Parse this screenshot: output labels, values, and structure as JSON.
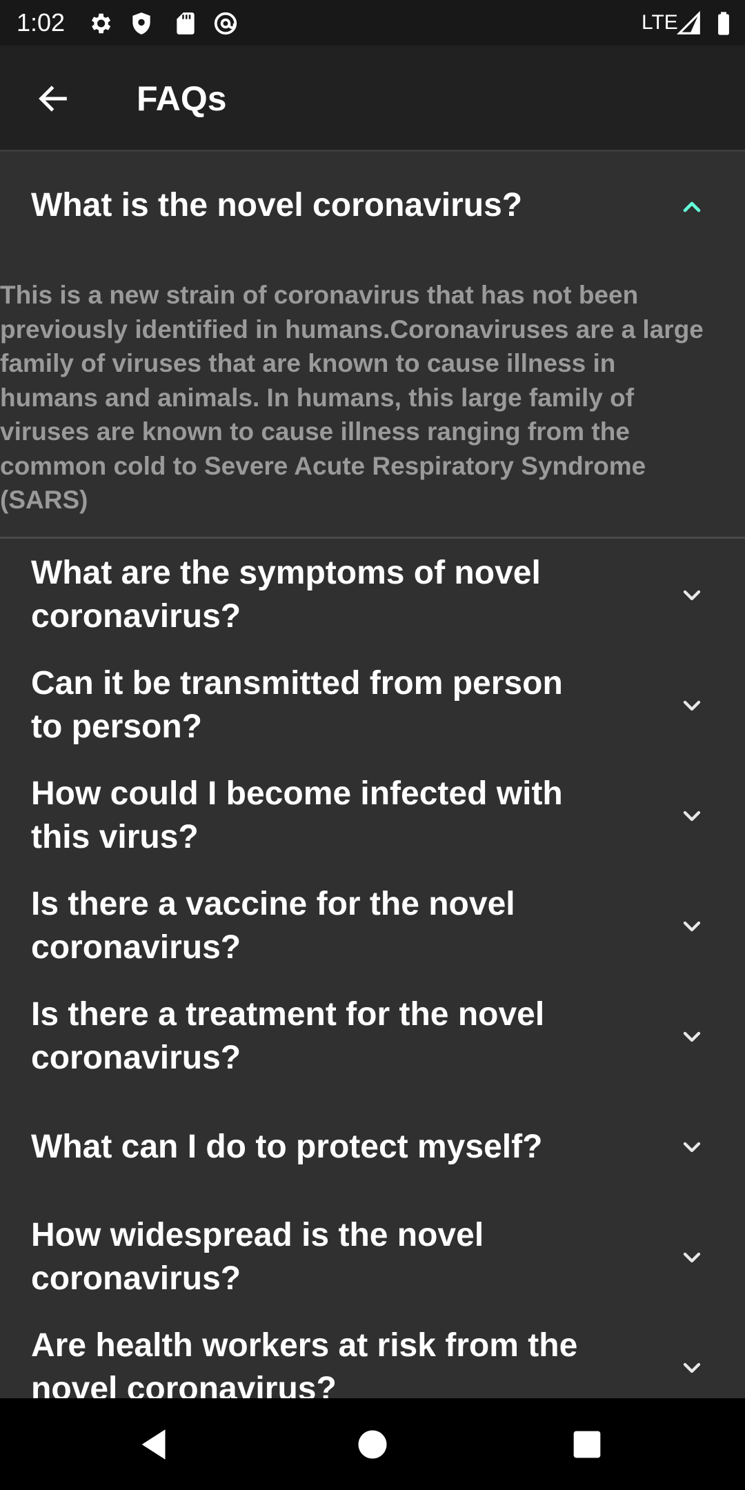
{
  "status_bar": {
    "time": "1:02",
    "network": "LTE",
    "icons": [
      "gear-icon",
      "shield-icon",
      "sd-card-icon",
      "at-sign-icon",
      "signal-icon",
      "battery-icon"
    ]
  },
  "app_bar": {
    "title": "FAQs",
    "back_icon": "arrow-back-icon"
  },
  "colors": {
    "background": "#303030",
    "app_bar": "#212121",
    "status_bar": "#181818",
    "accent": "#64ffda",
    "answer_text": "#9a9a9a"
  },
  "faqs": [
    {
      "question": "What is the novel coronavirus?",
      "expanded": true,
      "answer_lines": [
        "This is a new strain of coronavirus that has not been",
        "previously identified in humans.Coronaviruses are a large",
        "family of viruses that are known to cause illness in",
        "humans and animals. In humans, this large family of",
        "viruses are known to cause illness ranging from the",
        "common cold to Severe Acute Respiratory Syndrome",
        "(SARS)"
      ]
    },
    {
      "question_lines": [
        "What are the symptoms of novel",
        "coronavirus?"
      ],
      "expanded": false
    },
    {
      "question_lines": [
        "Can it be transmitted from person",
        "to person?"
      ],
      "expanded": false
    },
    {
      "question_lines": [
        "How could I become infected with",
        "this virus?"
      ],
      "expanded": false
    },
    {
      "question_lines": [
        "Is there a vaccine for the novel",
        "coronavirus?"
      ],
      "expanded": false
    },
    {
      "question_lines": [
        "Is there a treatment for the novel",
        "coronavirus?"
      ],
      "expanded": false
    },
    {
      "question_lines": [
        "What can I do to protect myself?"
      ],
      "expanded": false
    },
    {
      "question_lines": [
        "How widespread is the novel",
        "coronavirus?"
      ],
      "expanded": false
    },
    {
      "question_lines": [
        "Are health workers at risk from the",
        "novel coronavirus?"
      ],
      "expanded": false
    }
  ],
  "nav_bar": {
    "buttons": [
      "back-triangle-icon",
      "home-circle-icon",
      "recents-square-icon"
    ]
  }
}
